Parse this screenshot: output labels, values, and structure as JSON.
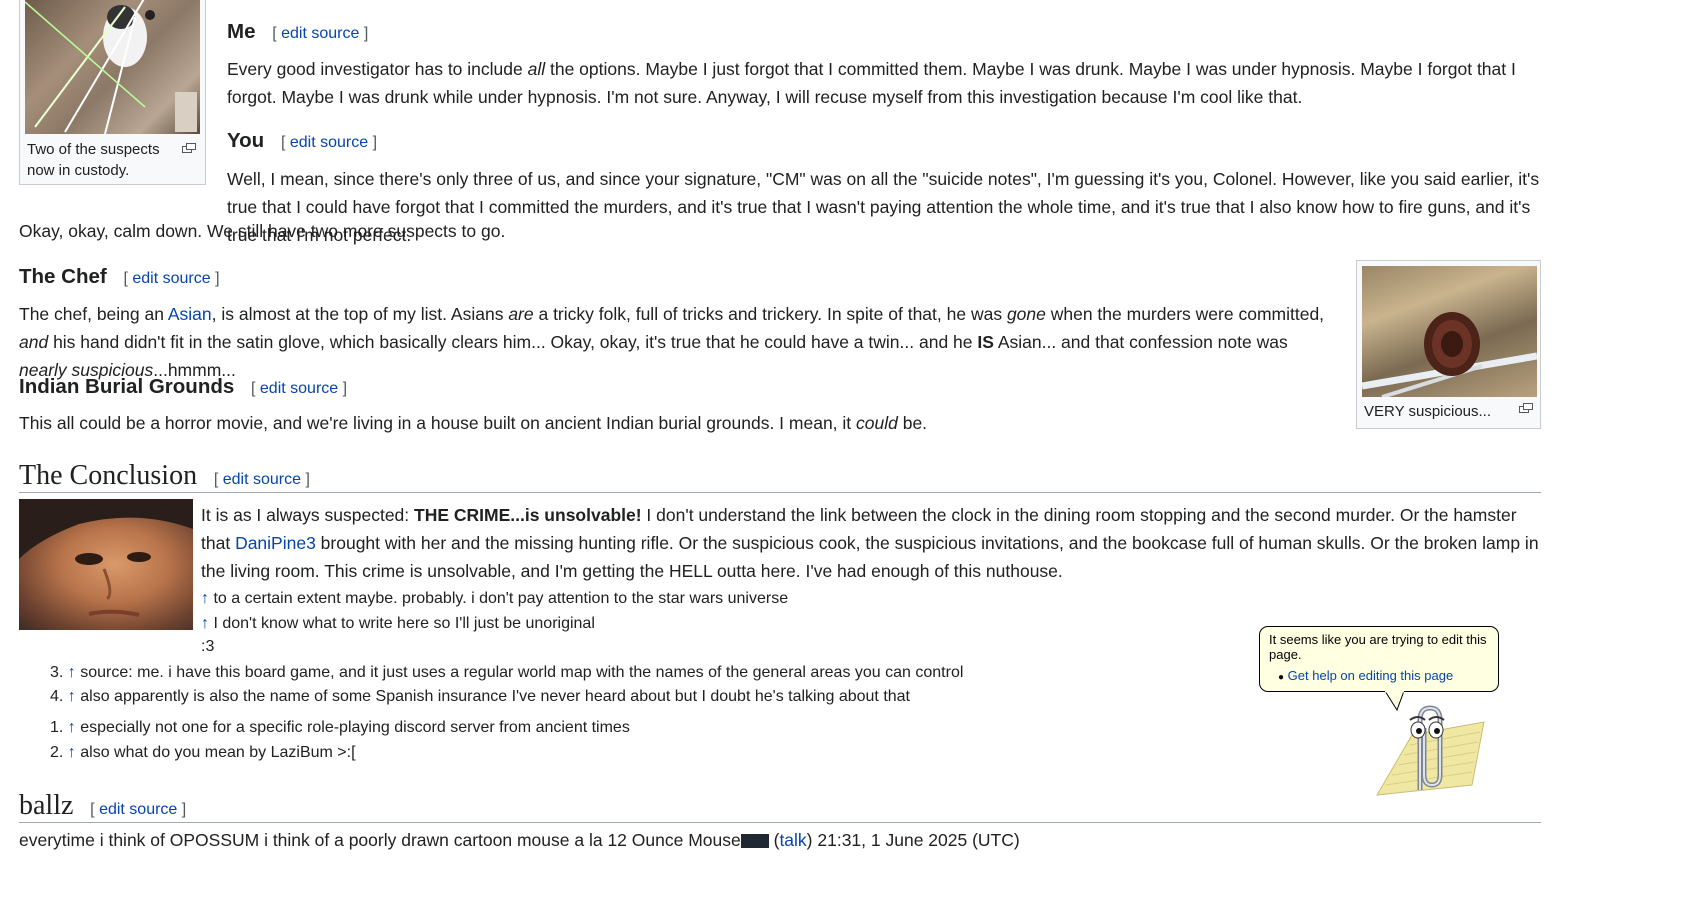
{
  "thumbs": {
    "suspects_caption": "Two of the suspects now in custody.",
    "pinecone_caption": "VERY suspicious..."
  },
  "edit": {
    "open": "[",
    "label": "edit source",
    "close": "]"
  },
  "sections": {
    "me": {
      "title": "Me",
      "text_pre": "Every good investigator has to include ",
      "text_em": "all",
      "text_post": " the options. Maybe I just forgot that I committed them. Maybe I was drunk. Maybe I was under hypnosis. Maybe I forgot that I forgot. Maybe I was drunk while under hypnosis. I'm not sure. Anyway, I will recuse myself from this investigation because I'm cool like that."
    },
    "you": {
      "title": "You",
      "text": "Well, I mean, since there's only three of us, and since your signature, \"CM\" was on all the \"suicide notes\", I'm guessing it's you, Colonel. However, like you said earlier, it's true that I could have forgot that I committed the murders, and it's true that I wasn't paying attention the whole time, and it's true that I also know how to fire guns, and it's true that I'm not perfect.",
      "followup": "Okay, okay, calm down. We still have two more suspects to go."
    },
    "chef": {
      "title": "The Chef",
      "t1": "The chef, being an ",
      "link_asian": "Asian",
      "t2": ", is almost at the top of my list. Asians ",
      "em_are": "are",
      "t3": " a tricky folk, full of tricks and trickery. In spite of that, he was ",
      "em_gone": "gone",
      "t4": " when the murders were committed, ",
      "em_and": "and",
      "t5": " his hand didn't fit in the satin glove, which basically clears him... Okay, okay, it's true that he could have a twin... and he ",
      "bold_is": "IS",
      "t6": " Asian... and that confession note was ",
      "em_nearly": "nearly suspicious",
      "t7": "...hmmm..."
    },
    "burial": {
      "title": "Indian Burial Grounds",
      "t1": "This all could be a horror movie, and we're living in a house built on ancient Indian burial grounds. I mean, it ",
      "em_could": "could",
      "t2": " be."
    },
    "conclusion": {
      "title": "The Conclusion",
      "t1": "It is as I always suspected: ",
      "bold": "THE CRIME...is unsolvable!",
      "t2": " I don't understand the link between the clock in the dining room stopping and the second murder. Or the hamster that ",
      "link_dani": "DaniPine3",
      "t3": " brought with her and the missing hunting rifle. Or the suspicious cook, the suspicious invitations, and the bookcase full of human skulls. Or the broken lamp in the living room. This crime is unsolvable, and I'm getting the HELL outta here. I've had enough of this nuthouse."
    },
    "ballz": {
      "title": "ballz",
      "t1": "everytime i think of OPOSSUM i think of a poorly drawn cartoon mouse a la 12 Ounce Mouse",
      "talk": "talk",
      "t2": ") 21:31, 1 June 2025 (UTC)"
    }
  },
  "notes": {
    "arrow": "↑",
    "n1": "to a certain extent maybe. probably. i don't pay attention to the star wars universe",
    "n2": "I don't know what to write here so I'll just be unoriginal",
    "n2b": ":3",
    "list_a": [
      {
        "num": "3.",
        "text": "source: me. i have this board game, and it just uses a regular world map with the names of the general areas you can control"
      },
      {
        "num": "4.",
        "text": "also apparently is also the name of some Spanish insurance I've never heard about but I doubt he's talking about that"
      }
    ],
    "list_b": [
      {
        "num": "1.",
        "text": "especially not one for a specific role-playing discord server from ancient times"
      },
      {
        "num": "2.",
        "text": "also what do you mean by LaziBum >:["
      }
    ]
  },
  "clippy": {
    "message": "It seems like you are trying to edit this page.",
    "link": "Get help on editing this page"
  }
}
